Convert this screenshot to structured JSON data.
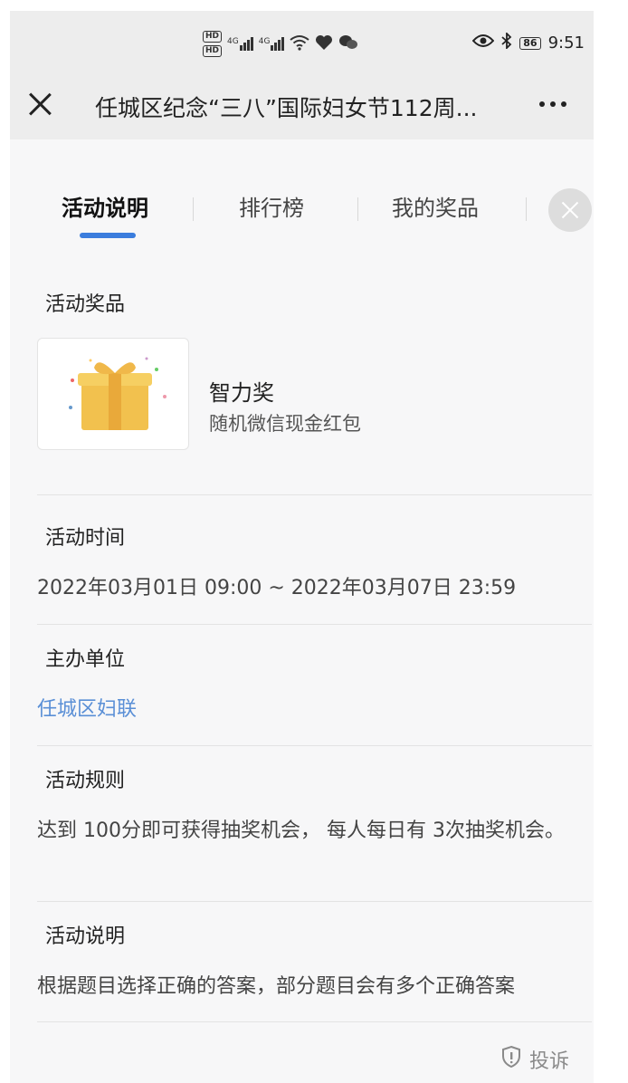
{
  "status_bar": {
    "sim1": "HD",
    "sim2": "HD",
    "network1": "4G",
    "network2": "4G",
    "battery": "86",
    "time": "9:51"
  },
  "title_bar": {
    "title": "任城区纪念“三八”国际妇女节112周..."
  },
  "tabs": [
    {
      "label": "活动说明",
      "active": true
    },
    {
      "label": "排行榜",
      "active": false
    },
    {
      "label": "我的奖品",
      "active": false
    }
  ],
  "prizes_section": {
    "label": "活动奖品",
    "prize_name": "智力奖",
    "prize_desc": "随机微信现金红包"
  },
  "time_section": {
    "label": "活动时间",
    "value": "2022年03月01日 09:00 ~ 2022年03月07日 23:59"
  },
  "organizer_section": {
    "label": "主办单位",
    "value": "任城区妇联"
  },
  "rules_section": {
    "label": "活动规则",
    "value": "达到 100分即可获得抽奖机会， 每人每日有 3次抽奖机会。"
  },
  "description_section": {
    "label": "活动说明",
    "value": "根据题目选择正确的答案，部分题目会有多个正确答案"
  },
  "report": {
    "label": "投诉"
  },
  "colors": {
    "tab_indicator": "#3b7ddd",
    "link": "#5a8fd6",
    "gift_box": "#f2c14e"
  }
}
